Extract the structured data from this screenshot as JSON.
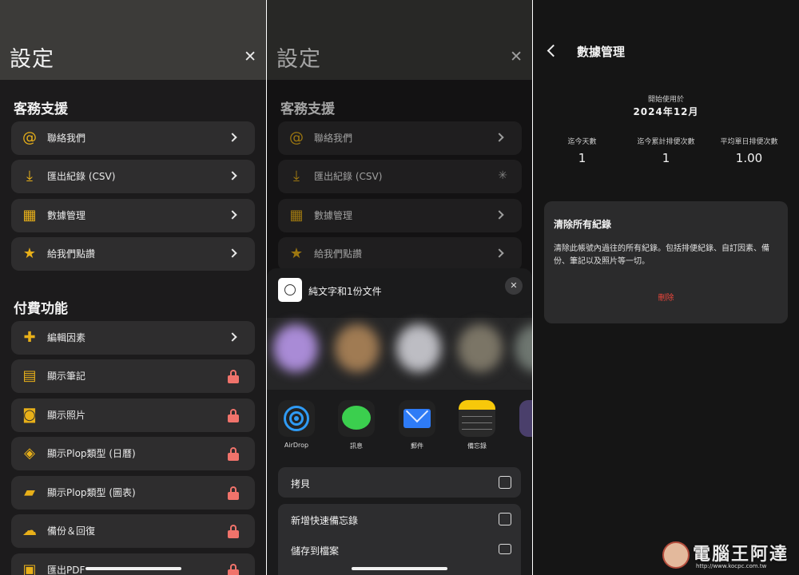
{
  "settings": {
    "title": "設定",
    "close_glyph": "✕",
    "support_header": "客務支援",
    "support_items": [
      {
        "label": "聯絡我們",
        "icon": "at-sign-icon",
        "glyph": "@"
      },
      {
        "label": "匯出紀錄 (CSV)",
        "icon": "download-icon",
        "glyph": "⤓"
      },
      {
        "label": "數據管理",
        "icon": "grid-icon",
        "glyph": "▦"
      },
      {
        "label": "給我們點讚",
        "icon": "star-icon",
        "glyph": "★"
      }
    ],
    "paid_header": "付費功能",
    "paid_items": [
      {
        "label": "編輯因素",
        "icon": "puzzle-icon",
        "glyph": "✚",
        "locked": false
      },
      {
        "label": "顯示筆記",
        "icon": "note-icon",
        "glyph": "▤",
        "locked": true
      },
      {
        "label": "顯示照片",
        "icon": "camera-icon",
        "glyph": "◙",
        "locked": true
      },
      {
        "label": "顯示Plop類型 (日曆)",
        "icon": "layers-icon",
        "glyph": "◈",
        "locked": true
      },
      {
        "label": "顯示Plop類型 (圖表)",
        "icon": "tag-icon",
        "glyph": "▰",
        "locked": true
      },
      {
        "label": "備份＆回復",
        "icon": "cloud-upload-icon",
        "glyph": "☁",
        "locked": true
      },
      {
        "label": "匯出PDF",
        "icon": "pdf-icon",
        "glyph": "▣",
        "locked": true
      }
    ]
  },
  "share_sheet": {
    "doc_title": "純文字和1份文件",
    "apps": [
      {
        "label": "AirDrop",
        "icon": "airdrop-icon"
      },
      {
        "label": "訊息",
        "icon": "messages-icon"
      },
      {
        "label": "郵件",
        "icon": "mail-icon"
      },
      {
        "label": "備忘錄",
        "icon": "notes-icon"
      }
    ],
    "actions": [
      {
        "label": "拷貝",
        "icon": "copy-icon"
      },
      {
        "label": "新增快速備忘錄",
        "icon": "quick-note-icon"
      },
      {
        "label": "儲存到檔案",
        "icon": "folder-icon"
      }
    ]
  },
  "data_mgmt": {
    "title": "數據管理",
    "since_label": "開始使用於",
    "since_value": "2024年12月",
    "stats": [
      {
        "label": "迄今天數",
        "value": "1"
      },
      {
        "label": "迄今累計排便次數",
        "value": "1"
      },
      {
        "label": "平均單日排便次數",
        "value": "1.00"
      }
    ],
    "clear_title": "清除所有紀錄",
    "clear_desc": "清除此帳號內過往的所有紀錄。包括排便紀錄、自訂因素、備份、筆記以及照片等一切。",
    "delete_label": "刪除"
  },
  "watermark": {
    "text": "電腦王阿達",
    "url": "http://www.kocpc.com.tw"
  },
  "colors": {
    "accent": "#e8b019",
    "lock": "#f0736b",
    "delete": "#e8463b"
  }
}
